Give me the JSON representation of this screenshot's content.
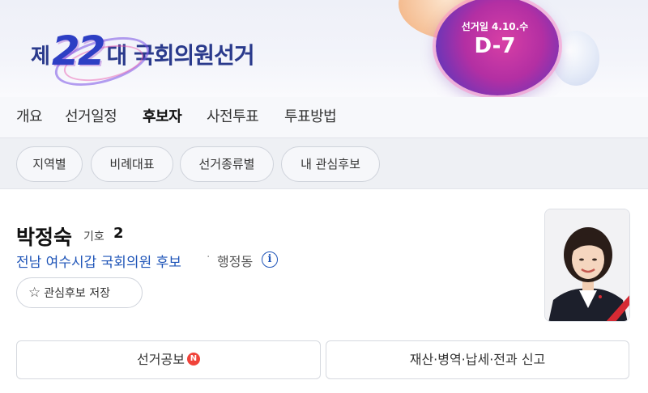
{
  "banner": {
    "logo_prefix": "제",
    "logo_number": "22",
    "logo_suffix": "대 국회의원선거",
    "election_date_label": "선거일 4.10.수",
    "dday": "D-7",
    "accent_color": "#2d3fc4"
  },
  "tabs": [
    {
      "label": "개요",
      "active": false
    },
    {
      "label": "선거일정",
      "active": false
    },
    {
      "label": "후보자",
      "active": true
    },
    {
      "label": "사전투표",
      "active": false
    },
    {
      "label": "투표방법",
      "active": false
    }
  ],
  "filters": [
    {
      "label": "지역별"
    },
    {
      "label": "비례대표"
    },
    {
      "label": "선거종류별"
    },
    {
      "label": "내 관심후보"
    }
  ],
  "candidate": {
    "name": "박정숙",
    "symbol_label": "기호",
    "symbol_number": "2",
    "district": "전남 여수시갑 국회의원 후보",
    "separator": "·",
    "dong": "행정동",
    "info_icon": "i",
    "favorite_button": "관심후보 저장",
    "favorite_icon": "star-outline-icon"
  },
  "actions": {
    "pledge_label": "선거공보",
    "new_badge": "N",
    "report_label": "재산·병역·납세·전과 신고",
    "badge_color": "#f0433a"
  }
}
